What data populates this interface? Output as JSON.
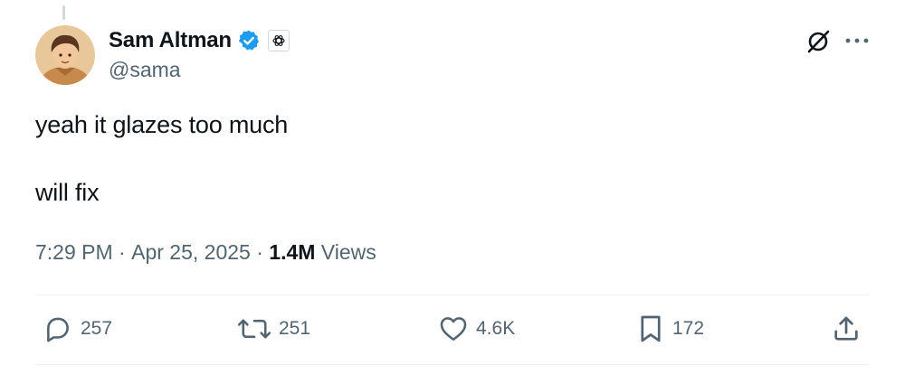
{
  "author": {
    "display_name": "Sam Altman",
    "handle": "@sama",
    "verified_badge": "verified-badge-icon",
    "affiliate_badge": "openai-logo-icon"
  },
  "header_actions": {
    "grok_icon": "grok-icon",
    "more_icon": "more-icon"
  },
  "tweet": {
    "line1": "yeah it glazes too much",
    "line2": "will fix"
  },
  "meta": {
    "time": "7:29 PM",
    "separator": " · ",
    "date": "Apr 25, 2025",
    "views_count": "1.4M",
    "views_label": " Views"
  },
  "actions": {
    "replies": "257",
    "reposts": "251",
    "likes": "4.6K",
    "bookmarks": "172",
    "share_icon": "share-icon"
  },
  "colors": {
    "text_primary": "#0f1419",
    "text_secondary": "#536471",
    "verified_blue": "#1d9bf0",
    "divider": "#eff3f4"
  }
}
